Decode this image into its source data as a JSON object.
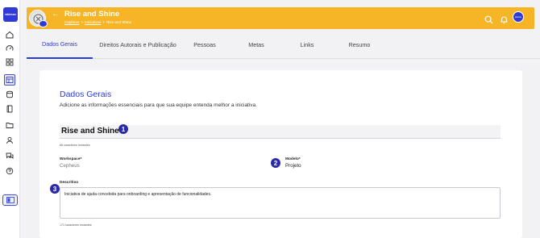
{
  "app": {
    "logo_text": "wkimax"
  },
  "header": {
    "title": "Rise and Shine",
    "breadcrumb": [
      "Cepheus",
      "Iniciativas",
      "Rise and Shine"
    ],
    "avatar_label": "wkimax"
  },
  "tabs": [
    {
      "label": "Dados Gerais",
      "active": true
    },
    {
      "label": "Direitos Autorais e Publicação",
      "active": false
    },
    {
      "label": "Pessoas",
      "active": false
    },
    {
      "label": "Metas",
      "active": false
    },
    {
      "label": "Links",
      "active": false
    },
    {
      "label": "Resumo",
      "active": false
    }
  ],
  "form": {
    "section_title": "Dados Gerais",
    "section_subtitle": "Adicione as informações essenciais para que sua equipe entenda melhor a iniciativa.",
    "name_value": "Rise and Shine",
    "name_hint": "66 caracteres restantes",
    "workspace_label": "Workspace*",
    "workspace_value": "Cepheus",
    "modelo_label": "Modelo*",
    "modelo_value": "Projeto",
    "descritivo_label": "Descritivo",
    "descritivo_value": "Iniciativa de ajuda concebida para onboarding e apresentação de funcionalidades.",
    "descritivo_hint": "171 caracteres restantes"
  },
  "markers": [
    "1",
    "2",
    "3"
  ],
  "colors": {
    "accent": "#2f3ad6",
    "header_bg": "#f6b526",
    "marker": "#2a2aa6"
  }
}
